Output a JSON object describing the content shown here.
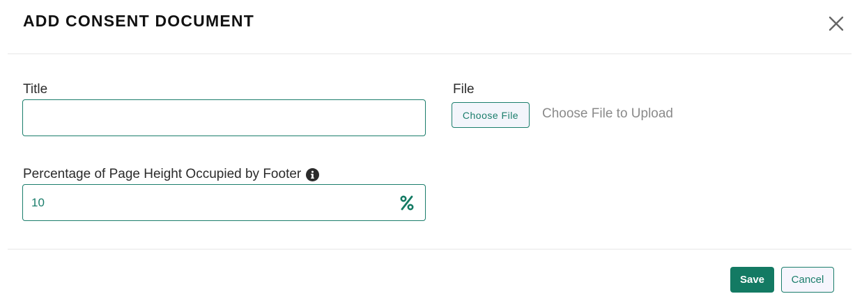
{
  "dialog": {
    "title": "ADD CONSENT DOCUMENT",
    "close_icon": "close-icon"
  },
  "form": {
    "title_field": {
      "label": "Title",
      "value": "",
      "placeholder": ""
    },
    "file_field": {
      "label": "File",
      "button_label": "Choose File",
      "status_text": "Choose File to Upload"
    },
    "footer_percentage": {
      "label": "Percentage of Page Height Occupied by Footer",
      "info_icon": "info-icon",
      "value": "10",
      "unit_icon": "percent-icon"
    }
  },
  "footer": {
    "save_label": "Save",
    "cancel_label": "Cancel"
  },
  "colors": {
    "accent": "#137a63",
    "border": "#1a7d6b",
    "muted_text": "#8a8a8a"
  }
}
